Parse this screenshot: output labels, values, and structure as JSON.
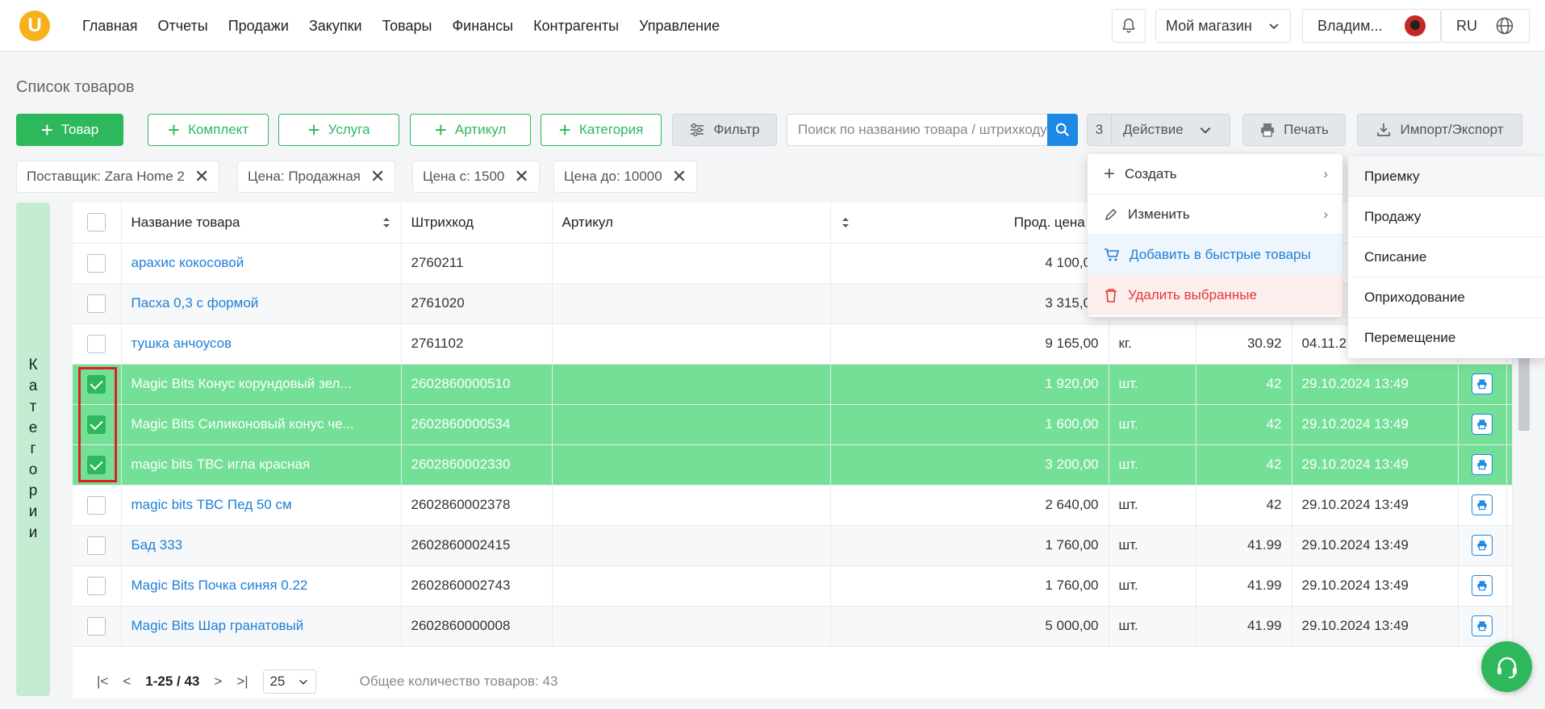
{
  "nav": {
    "logo": "U",
    "items": [
      "Главная",
      "Отчеты",
      "Продажи",
      "Закупки",
      "Товары",
      "Финансы",
      "Контрагенты",
      "Управление"
    ],
    "store": "Мой магазин",
    "user": "Владим...",
    "lang": "RU"
  },
  "page_title": "Список товаров",
  "toolbar": {
    "product": "Товар",
    "kit": "Комплект",
    "service": "Услуга",
    "article": "Артикул",
    "category": "Категория",
    "filter": "Фильтр",
    "search_placeholder": "Поиск по названию товара / штрихкоду",
    "selected_count": "3",
    "action": "Действие",
    "print": "Печать",
    "import_export": "Импорт/Экспорт"
  },
  "filters": [
    "Поставщик: Zara Home 2",
    "Цена: Продажная",
    "Цена с: 1500",
    "Цена до: 10000"
  ],
  "sidebar_label": [
    "К",
    "а",
    "т",
    "е",
    "г",
    "о",
    "р",
    "и",
    "и"
  ],
  "table": {
    "headers": {
      "name": "Название товара",
      "barcode": "Штрихкод",
      "article": "Артикул",
      "price": "Прод. цена"
    },
    "rows": [
      {
        "name": "арахис кокосовой",
        "barcode": "2760211",
        "price": "4 100,00",
        "unit": "",
        "qty": "",
        "date": "",
        "selected": false,
        "alt": false
      },
      {
        "name": "Пасха 0,3 с формой",
        "barcode": "2761020",
        "price": "3 315,00",
        "unit": "",
        "qty": "",
        "date": "",
        "selected": false,
        "alt": true
      },
      {
        "name": "тушка анчоусов",
        "barcode": "2761102",
        "price": "9 165,00",
        "unit": "кг.",
        "qty": "30.92",
        "date": "04.11.2",
        "selected": false,
        "alt": false
      },
      {
        "name": "Magic Bits Конус корундовый зел...",
        "barcode": "2602860000510",
        "price": "1 920,00",
        "unit": "шт.",
        "qty": "42",
        "date": "29.10.2024 13:49",
        "selected": true,
        "alt": false
      },
      {
        "name": "Magic Bits Силиконовый конус че...",
        "barcode": "2602860000534",
        "price": "1 600,00",
        "unit": "шт.",
        "qty": "42",
        "date": "29.10.2024 13:49",
        "selected": true,
        "alt": false
      },
      {
        "name": "magic bits ТВС игла красная",
        "barcode": "2602860002330",
        "price": "3 200,00",
        "unit": "шт.",
        "qty": "42",
        "date": "29.10.2024 13:49",
        "selected": true,
        "alt": false
      },
      {
        "name": "magic bits ТВС Пед 50 см",
        "barcode": "2602860002378",
        "price": "2 640,00",
        "unit": "шт.",
        "qty": "42",
        "date": "29.10.2024 13:49",
        "selected": false,
        "alt": false
      },
      {
        "name": "Бад 333",
        "barcode": "2602860002415",
        "price": "1 760,00",
        "unit": "шт.",
        "qty": "41.99",
        "date": "29.10.2024 13:49",
        "selected": false,
        "alt": true
      },
      {
        "name": "Magic Bits Почка синяя 0.22",
        "barcode": "2602860002743",
        "price": "1 760,00",
        "unit": "шт.",
        "qty": "41.99",
        "date": "29.10.2024 13:49",
        "selected": false,
        "alt": false
      },
      {
        "name": "Magic Bits Шар гранатовый",
        "barcode": "2602860000008",
        "price": "5 000,00",
        "unit": "шт.",
        "qty": "41.99",
        "date": "29.10.2024 13:49",
        "selected": false,
        "alt": true
      }
    ]
  },
  "footer": {
    "range": "1-25 / 43",
    "page_size": "25",
    "total": "Общее количество товаров: 43"
  },
  "action_menu": {
    "create": "Создать",
    "edit": "Изменить",
    "add_quick": "Добавить в быстрые товары",
    "delete": "Удалить выбранные"
  },
  "create_submenu": [
    "Приемку",
    "Продажу",
    "Списание",
    "Оприходование",
    "Перемещение"
  ],
  "colors": {
    "accent": "#2eb85c",
    "link": "#1e7fd8",
    "selected_row": "#74df96",
    "danger": "#e53935",
    "highlight": "#e02020"
  }
}
